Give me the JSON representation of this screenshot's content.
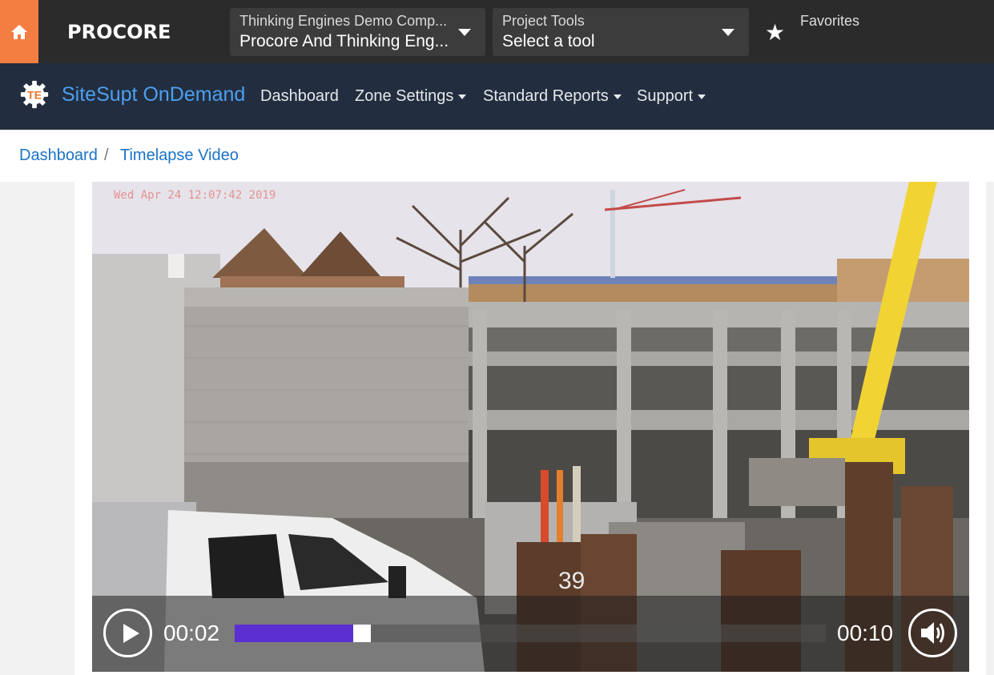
{
  "procore": {
    "home_icon": "home-icon",
    "logo": "PROCORE",
    "company_selector": {
      "label": "Thinking Engines Demo Comp...",
      "value": "Procore And Thinking Eng..."
    },
    "tool_selector": {
      "label": "Project Tools",
      "value": "Select a tool"
    },
    "favorites": {
      "icon": "star-icon",
      "label": "Favorites"
    },
    "accent_color": "#f47e42"
  },
  "app": {
    "logo_text": "TE",
    "title": "SiteSupt OnDemand",
    "nav": [
      {
        "label": "Dashboard",
        "dropdown": false
      },
      {
        "label": "Zone Settings",
        "dropdown": true
      },
      {
        "label": "Standard Reports",
        "dropdown": true
      },
      {
        "label": "Support",
        "dropdown": true
      }
    ],
    "title_color": "#4d9ff0",
    "nav_bg": "#222e3f"
  },
  "breadcrumb": [
    {
      "label": "Dashboard"
    },
    {
      "label": "Timelapse Video"
    }
  ],
  "breadcrumb_separator": "/",
  "video": {
    "timestamp": "Wed Apr 24 12:07:42 2019",
    "plate_number": "39",
    "current_time": "00:02",
    "total_time": "00:10",
    "progress": 0.2,
    "buffered": 0.23,
    "play_icon": "play-icon",
    "volume_icon": "volume-icon",
    "progress_color": "#5b2fd1"
  }
}
